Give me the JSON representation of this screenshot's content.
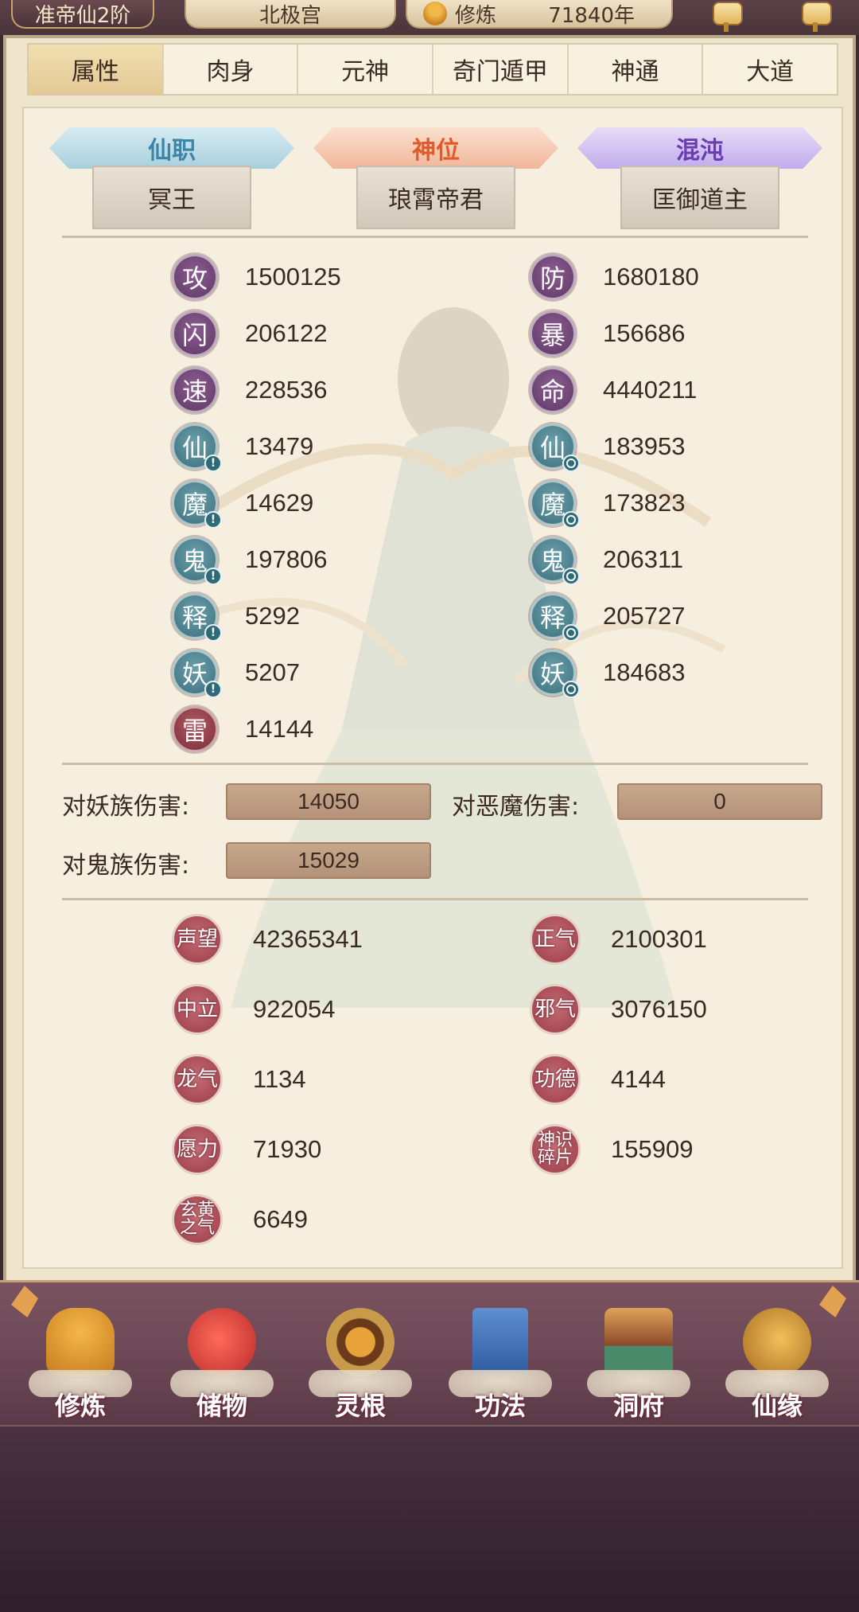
{
  "topbar": {
    "rank": "准帝仙2阶",
    "palace": "北极宫",
    "cultivation_label": "修炼",
    "cultivation_value": "71840年"
  },
  "tabs": [
    "属性",
    "肉身",
    "元神",
    "奇门遁甲",
    "神通",
    "大道"
  ],
  "active_tab": "属性",
  "titles": {
    "xianzhi": {
      "label": "仙职",
      "value": "冥王"
    },
    "shenwei": {
      "label": "神位",
      "value": "琅霄帝君"
    },
    "hundun": {
      "label": "混沌",
      "value": "匡御道主"
    }
  },
  "attributes_left": [
    {
      "char": "攻",
      "value": "1500125"
    },
    {
      "char": "闪",
      "value": "206122"
    },
    {
      "char": "速",
      "value": "228536"
    },
    {
      "char": "仙",
      "value": "13479"
    },
    {
      "char": "魔",
      "value": "14629"
    },
    {
      "char": "鬼",
      "value": "197806"
    },
    {
      "char": "释",
      "value": "5292"
    },
    {
      "char": "妖",
      "value": "5207"
    },
    {
      "char": "雷",
      "value": "14144"
    }
  ],
  "attributes_right": [
    {
      "char": "防",
      "value": "1680180"
    },
    {
      "char": "暴",
      "value": "156686"
    },
    {
      "char": "命",
      "value": "4440211"
    },
    {
      "char": "仙",
      "value": "183953"
    },
    {
      "char": "魔",
      "value": "173823"
    },
    {
      "char": "鬼",
      "value": "206311"
    },
    {
      "char": "释",
      "value": "205727"
    },
    {
      "char": "妖",
      "value": "184683"
    }
  ],
  "damage": {
    "demon_race_label": "对妖族伤害:",
    "demon_race_value": "14050",
    "evil_demon_label": "对恶魔伤害:",
    "evil_demon_value": "0",
    "ghost_race_label": "对鬼族伤害:",
    "ghost_race_value": "15029"
  },
  "reputation": {
    "shengwang": {
      "label": "声望",
      "value": "42365341"
    },
    "zhengqi": {
      "label": "正气",
      "value": "2100301"
    },
    "zhongli": {
      "label": "中立",
      "value": "922054"
    },
    "xieqi": {
      "label": "邪气",
      "value": "3076150"
    },
    "longqi": {
      "label": "龙气",
      "value": "1134"
    },
    "gongde": {
      "label": "功德",
      "value": "4144"
    },
    "yuanli": {
      "label": "愿力",
      "value": "71930"
    },
    "shenshi": {
      "label": "神识碎片",
      "value": "155909"
    },
    "xuanhuang": {
      "label": "玄黄之气",
      "value": "6649"
    }
  },
  "bottom_nav": [
    "修炼",
    "储物",
    "灵根",
    "功法",
    "洞府",
    "仙缘"
  ],
  "colors": {
    "panel_bg": "#f6efdf",
    "xianzhi": "#3b86a8",
    "shenwei": "#e05a2a",
    "hundun": "#6a3db3",
    "badge_purple": "#5e3866",
    "badge_teal": "#3c6f7c",
    "badge_crimson": "#7a2e3a"
  }
}
